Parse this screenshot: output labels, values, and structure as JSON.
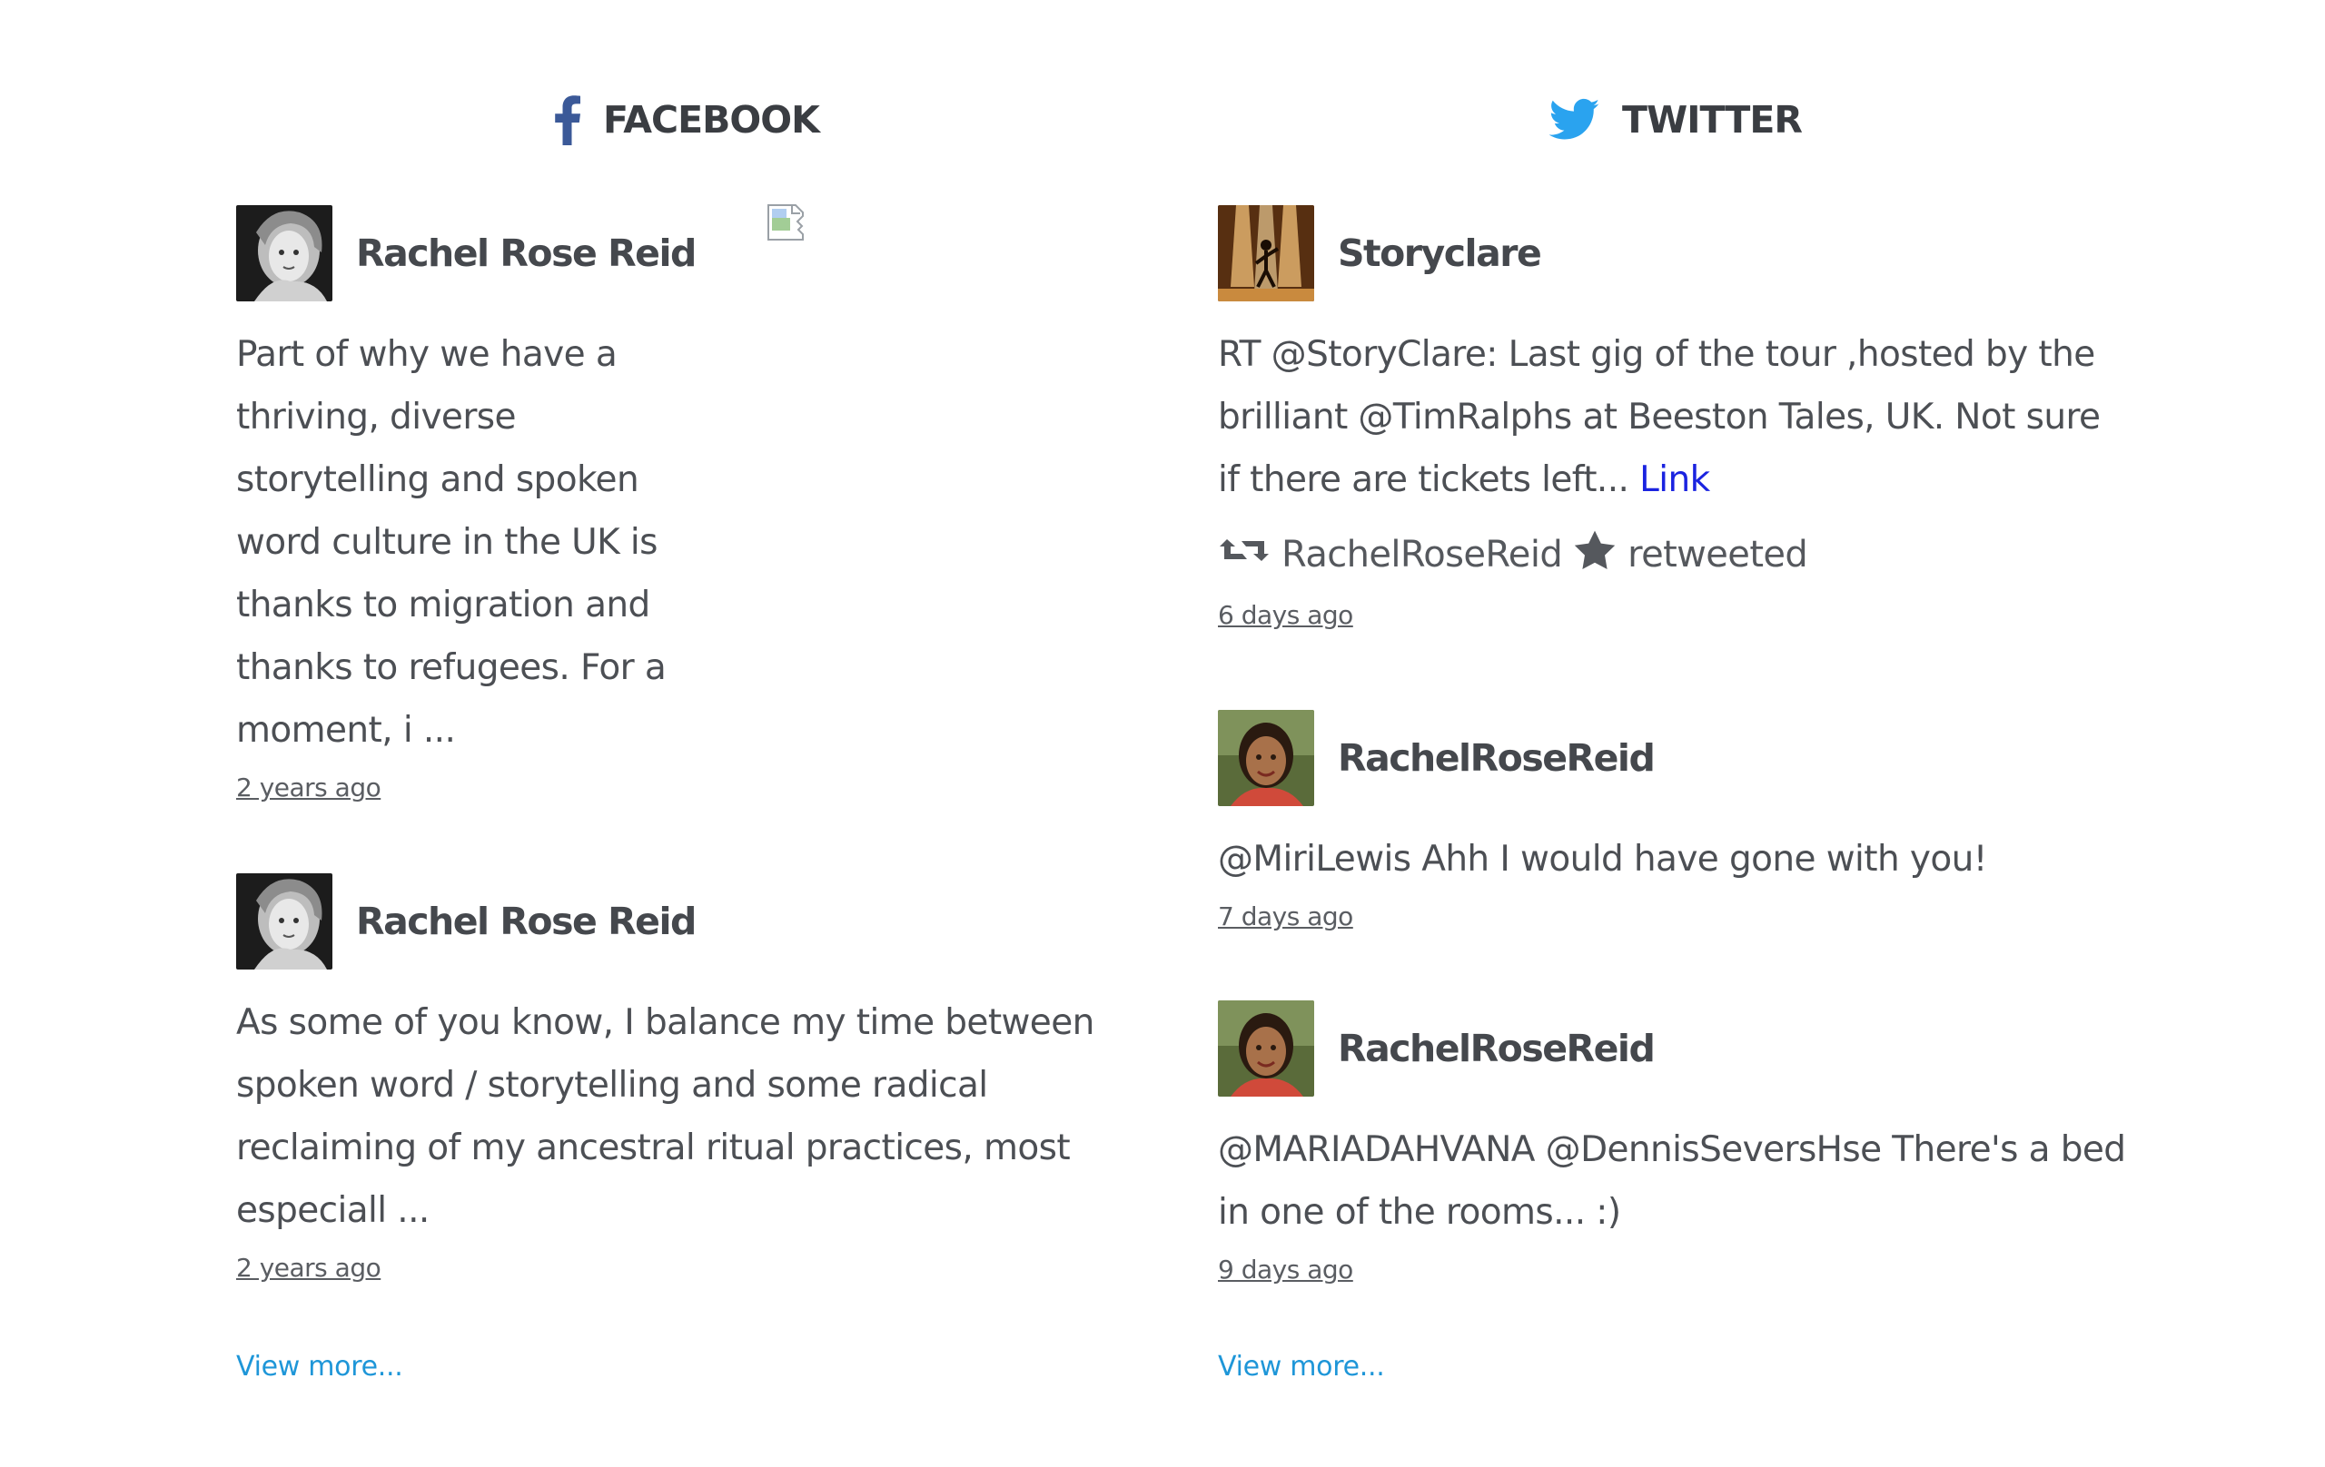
{
  "facebook": {
    "header": "FACEBOOK",
    "icon": "facebook-icon",
    "brand_color": "#3b5998",
    "posts": [
      {
        "author": "Rachel Rose Reid",
        "avatar": "avatar-bw-portrait",
        "text": "Part of why we have a thriving, diverse storytelling and spoken word culture in the UK is thanks to migration and thanks to refugees. For a moment, i ...",
        "timestamp": "2 years ago"
      },
      {
        "author": "Rachel Rose Reid",
        "avatar": "avatar-bw-portrait",
        "text": "As some of you know, I balance my time between spoken word / storytelling and some radical reclaiming of my ancestral ritual practices, most especiall ...",
        "timestamp": "2 years ago"
      }
    ],
    "view_more": "View more..."
  },
  "twitter": {
    "header": "TWITTER",
    "icon": "twitter-bird-icon",
    "brand_color": "#1da1f2",
    "posts": [
      {
        "author": "Storyclare",
        "avatar": "avatar-stage-performer",
        "text": "RT @StoryClare: Last gig of the tour ,hosted by the brilliant @TimRalphs at Beeston Tales, UK. Not sure if there are tickets left... ",
        "link": "Link",
        "retweet_user": "RachelRoseReid",
        "retweet_label": "retweeted",
        "timestamp": "6 days ago"
      },
      {
        "author": "RachelRoseReid",
        "avatar": "avatar-color-portrait",
        "text": "@MiriLewis Ahh I would have gone with you!",
        "timestamp": "7 days ago"
      },
      {
        "author": "RachelRoseReid",
        "avatar": "avatar-color-portrait",
        "text": "@MARIADAHVANA @DennisSeversHse There's a bed in one of the rooms... :)",
        "timestamp": "9 days ago"
      }
    ],
    "view_more": "View more..."
  },
  "colors": {
    "link_blue": "#1a23e0",
    "view_more": "#1e96d8",
    "text": "#4c4f54"
  }
}
